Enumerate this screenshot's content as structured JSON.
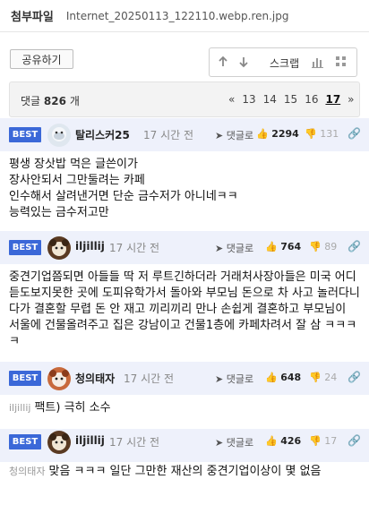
{
  "attachment": {
    "title": "첨부파일",
    "filename": "Internet_20250113_122110.webp.ren.jpg"
  },
  "share_label": "공유하기",
  "toolbar": {
    "scrap_label": "스크랩"
  },
  "comments_bar": {
    "label_prefix": "댓글",
    "count": "826",
    "label_suffix": "개",
    "pages": [
      "«",
      "13",
      "14",
      "15",
      "16",
      "17",
      "»"
    ],
    "current_page": "17"
  },
  "comments": [
    {
      "badge": "BEST",
      "author": "탈리스커25",
      "time": "17 시간 전",
      "reply_label": "댓글로",
      "likes": "2294",
      "dislikes": "131",
      "mention": "",
      "body": "평생 장삿밥 먹은 글쓴이가\n장사안되서 그만둘려는 카페\n인수해서 살려낸거면 단순 금수저가 아니네ㅋㅋ\n능력있는 금수저고만"
    },
    {
      "badge": "BEST",
      "author": "iljillij",
      "time": "17 시간 전",
      "reply_label": "댓글로",
      "likes": "764",
      "dislikes": "89",
      "mention": "",
      "body": "중견기업쯤되면 아들들 딱 저 루트긴하더라 거래처사장아들은 미국 어디 듣도보지못한 곳에 도피유학가서 돌아와 부모님 돈으로 차 사고 놀러다니다가 결혼할 무렵 돈 안 재고 끼리끼리 만나 손쉽게 결혼하고 부모님이 서울에 건물올려주고 집은 강남이고 건물1층에 카페차려서 잘 삼 ㅋㅋㅋㅋ"
    },
    {
      "badge": "BEST",
      "author": "청의태자",
      "time": "17 시간 전",
      "reply_label": "댓글로",
      "likes": "648",
      "dislikes": "24",
      "mention": "iljillij",
      "body": "팩트) 극히 소수"
    },
    {
      "badge": "BEST",
      "author": "iljillij",
      "time": "17 시간 전",
      "reply_label": "댓글로",
      "likes": "426",
      "dislikes": "17",
      "mention": "청의태자",
      "body": "맞음 ㅋㅋㅋ 일단 그만한 재산의 중견기업이상이 몇 없음"
    }
  ]
}
